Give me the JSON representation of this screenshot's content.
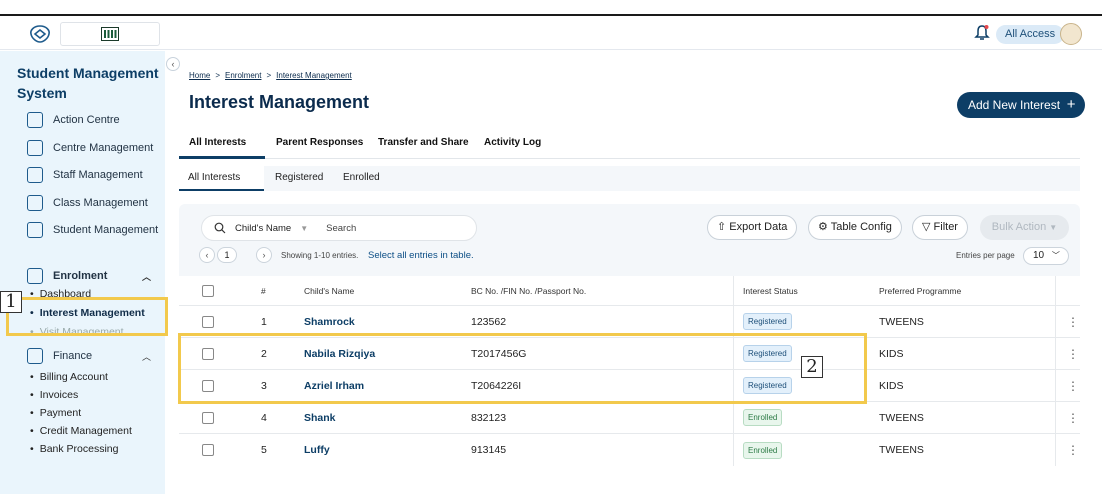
{
  "topbar": {
    "logo_text": "ꟷ",
    "access_label": "All Access"
  },
  "sidebar": {
    "title": "Student Management System",
    "items": [
      {
        "label": "Action Centre"
      },
      {
        "label": "Centre Management"
      },
      {
        "label": "Staff Management"
      },
      {
        "label": "Class Management"
      },
      {
        "label": "Student Management"
      }
    ],
    "enrolment": {
      "label": "Enrolment",
      "sub": [
        "Dashboard",
        "Interest Management",
        "Visit Management"
      ]
    },
    "finance": {
      "label": "Finance",
      "sub": [
        "Billing Account",
        "Invoices",
        "Payment",
        "Credit Management",
        "Bank Processing"
      ]
    }
  },
  "breadcrumb": {
    "home": "Home",
    "enrolment": "Enrolment",
    "current": "Interest Management",
    "sep": ">"
  },
  "page": {
    "title": "Interest Management",
    "add_button": "Add New Interest",
    "add_icon": "+"
  },
  "tabs": [
    "All Interests",
    "Parent Responses",
    "Transfer and Share",
    "Activity Log"
  ],
  "subtabs": [
    "All Interests",
    "Registered",
    "Enrolled"
  ],
  "toolbar": {
    "search_field": "Child's Name",
    "search_placeholder": "Search",
    "export": "Export Data",
    "table_config": "Table Config",
    "filter": "Filter",
    "bulk_action": "Bulk Action",
    "page": "1",
    "showing": "Showing 1-10 entries.",
    "select_all": "Select all entries in table.",
    "entries_per_page_label": "Entries per page",
    "entries_per_page": "10"
  },
  "table": {
    "headers": [
      "#",
      "Child's Name",
      "BC No. /FIN No. /Passport No.",
      "Interest Status",
      "Preferred Programme"
    ],
    "rows": [
      {
        "num": "1",
        "name": "Shamrock",
        "id": "123562",
        "status": "Registered",
        "programme": "TWEENS"
      },
      {
        "num": "2",
        "name": "Nabila Rizqiya",
        "id": "T2017456G",
        "status": "Registered",
        "programme": "KIDS"
      },
      {
        "num": "3",
        "name": "Azriel Irham",
        "id": "T2064226I",
        "status": "Registered",
        "programme": "KIDS"
      },
      {
        "num": "4",
        "name": "Shank",
        "id": "832123",
        "status": "Enrolled",
        "programme": "TWEENS"
      },
      {
        "num": "5",
        "name": "Luffy",
        "id": "913145",
        "status": "Enrolled",
        "programme": "TWEENS"
      }
    ]
  },
  "annotations": {
    "one": "1",
    "two": "2"
  },
  "colors": {
    "primary": "#0d3e66",
    "highlight": "#f2c94c",
    "sidebar_bg": "#eaf5fc"
  }
}
